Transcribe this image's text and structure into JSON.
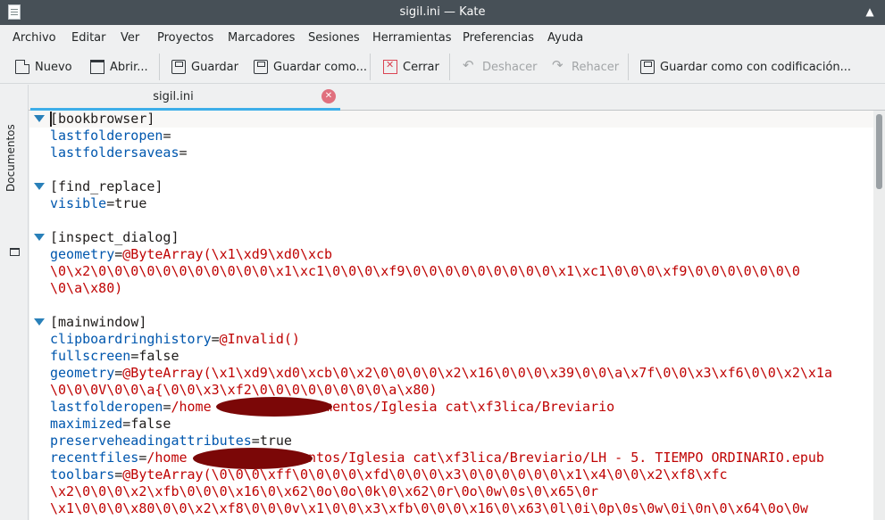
{
  "window": {
    "title": "sigil.ini — Kate"
  },
  "menubar": {
    "items": [
      "Archivo",
      "Editar",
      "Ver",
      "Proyectos",
      "Marcadores",
      "Sesiones",
      "Herramientas",
      "Preferencias",
      "Ayuda"
    ]
  },
  "toolbar": {
    "new_label": "Nuevo",
    "open_label": "Abrir...",
    "save_label": "Guardar",
    "save_as_label": "Guardar como...",
    "close_label": "Cerrar",
    "undo_label": "Deshacer",
    "redo_label": "Rehacer",
    "save_encoding_label": "Guardar como con codificación..."
  },
  "sidebar": {
    "documents_label": "Documentos"
  },
  "tabs": [
    {
      "label": "sigil.ini",
      "active": true
    }
  ],
  "editor": {
    "lines": [
      {
        "section": "[bookbrowser]",
        "fold": true
      },
      {
        "key": "lastfolderopen",
        "eq": "=",
        "value": ""
      },
      {
        "key": "lastfoldersaveas",
        "eq": "=",
        "value": ""
      },
      {
        "blank": true
      },
      {
        "section": "[find_replace]",
        "fold": true
      },
      {
        "key": "visible",
        "eq": "=",
        "value": "true"
      },
      {
        "blank": true
      },
      {
        "section": "[inspect_dialog]",
        "fold": true
      },
      {
        "key": "geometry",
        "eq": "=",
        "value": "@ByteArray(\\x1\\xd9\\xd0\\xcb"
      },
      {
        "cont": "\\0\\x2\\0\\0\\0\\0\\0\\0\\0\\0\\0\\0\\0\\x1\\xc1\\0\\0\\0\\xf9\\0\\0\\0\\0\\0\\0\\0\\0\\0\\x1\\xc1\\0\\0\\0\\xf9\\0\\0\\0\\0\\0\\0\\0"
      },
      {
        "cont": "\\0\\a\\x80)"
      },
      {
        "blank": true
      },
      {
        "section": "[mainwindow]",
        "fold": true
      },
      {
        "key": "clipboardringhistory",
        "eq": "=",
        "value": "@Invalid()"
      },
      {
        "key": "fullscreen",
        "eq": "=",
        "value": "false"
      },
      {
        "key": "geometry",
        "eq": "=",
        "value": "@ByteArray(\\x1\\xd9\\xd0\\xcb\\0\\x2\\0\\0\\0\\0\\x2\\x16\\0\\0\\0\\x39\\0\\0\\a\\x7f\\0\\0\\x3\\xf6\\0\\0\\x2\\x1a"
      },
      {
        "cont": "\\0\\0\\0V\\0\\0\\a{\\0\\0\\x3\\xf2\\0\\0\\0\\0\\0\\0\\0\\0\\a\\x80)"
      },
      {
        "key": "lastfolderopen",
        "eq": "=",
        "value": "/home            cumentos/Iglesia cat\\xf3lica/Breviario"
      },
      {
        "key": "maximized",
        "eq": "=",
        "value": "false"
      },
      {
        "key": "preserveheadingattributes",
        "eq": "=",
        "value": "true"
      },
      {
        "key": "recentfiles",
        "eq": "=",
        "value": "/home             mentos/Iglesia cat\\xf3lica/Breviario/LH - 5. TIEMPO ORDINARIO.epub"
      },
      {
        "key": "toolbars",
        "eq": "=",
        "value": "@ByteArray(\\0\\0\\0\\xff\\0\\0\\0\\0\\xfd\\0\\0\\0\\x3\\0\\0\\0\\0\\0\\0\\x1\\x4\\0\\0\\x2\\xf8\\xfc"
      },
      {
        "cont": "\\x2\\0\\0\\0\\x2\\xfb\\0\\0\\0\\x16\\0\\x62\\0o\\0o\\0k\\0\\x62\\0r\\0o\\0w\\0s\\0\\x65\\0r"
      },
      {
        "cont": "\\x1\\0\\0\\0\\x80\\0\\0\\x2\\xf8\\0\\0\\0v\\x1\\0\\0\\x3\\xfb\\0\\0\\0\\x16\\0\\x63\\0l\\0i\\0p\\0s\\0w\\0i\\0n\\0\\x64\\0o\\0w"
      }
    ]
  }
}
